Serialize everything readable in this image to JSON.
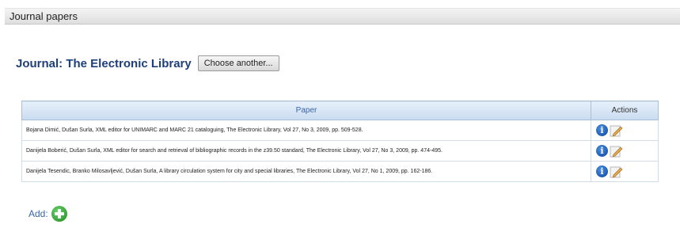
{
  "panel": {
    "title": "Journal papers"
  },
  "journal": {
    "label": "Journal: The Electronic Library",
    "choose_button": "Choose another..."
  },
  "table": {
    "headers": {
      "paper": "Paper",
      "actions": "Actions"
    },
    "rows": [
      {
        "paper": "Bojana Dimić, Dušan Surla, XML editor for UNIMARC and MARC 21 cataloguing, The Electronic Library, Vol 27, No 3, 2009, pp. 509-528."
      },
      {
        "paper": "Danijela Boberić, Dušan Surla, XML editor for search and retrieval of bibliographic records in the z39.50 standard, The Electronic Library, Vol 27, No 3, 2009, pp. 474-495."
      },
      {
        "paper": "Danijela Tesendic, Branko Milosavljević, Dušan Surla, A library circulation system for city and special libraries, The Electronic Library, Vol 27, No 1, 2009, pp. 162-186."
      }
    ],
    "row_icons": [
      "info-icon",
      "edit-icon"
    ]
  },
  "add": {
    "label": "Add:",
    "icon": "add-icon"
  },
  "colors": {
    "title_blue": "#1f3f7a",
    "header_blue": "#3a67a8",
    "info_blue": "#0b45a0",
    "add_green": "#1f8a1f"
  }
}
